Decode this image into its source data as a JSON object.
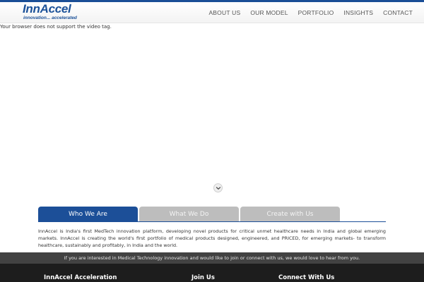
{
  "header": {
    "logo_name": "InnAccel",
    "logo_tagline": "innovation... accelerated",
    "nav": [
      "ABOUT US",
      "OUR MODEL",
      "PORTFOLIO",
      "INSIGHTS",
      "CONTACT"
    ]
  },
  "video": {
    "fallback_text": "Your browser does not support the video tag."
  },
  "tabs": [
    {
      "label": "Who We Are",
      "active": true
    },
    {
      "label": "What We Do",
      "active": false
    },
    {
      "label": "Create with Us",
      "active": false
    }
  ],
  "about_text": "InnAccel is India's first MedTech innovation platform, developing novel products for critical unmet healthcare needs in India and global emerging markets. InnAccel is creating the world's first portfolio of medical products designed, engineered, and PRICED, for emerging markets- to transform healthcare, sustainably and profitably, in India and the world.",
  "cta_text": "If you are interested in Medical Technology innovation and would like to join or connect with us, we would love to hear from you.",
  "footer": {
    "col1": "InnAccel Acceleration",
    "col2": "Join Us",
    "col3": "Connect With Us"
  },
  "colors": {
    "brand_blue": "#1c4f98",
    "tab_inactive": "#bdbdbd",
    "cta_bar": "#424242",
    "footer_bg": "#1d1d1d"
  },
  "icons": {
    "scroll_down": "chevron-down-icon"
  }
}
